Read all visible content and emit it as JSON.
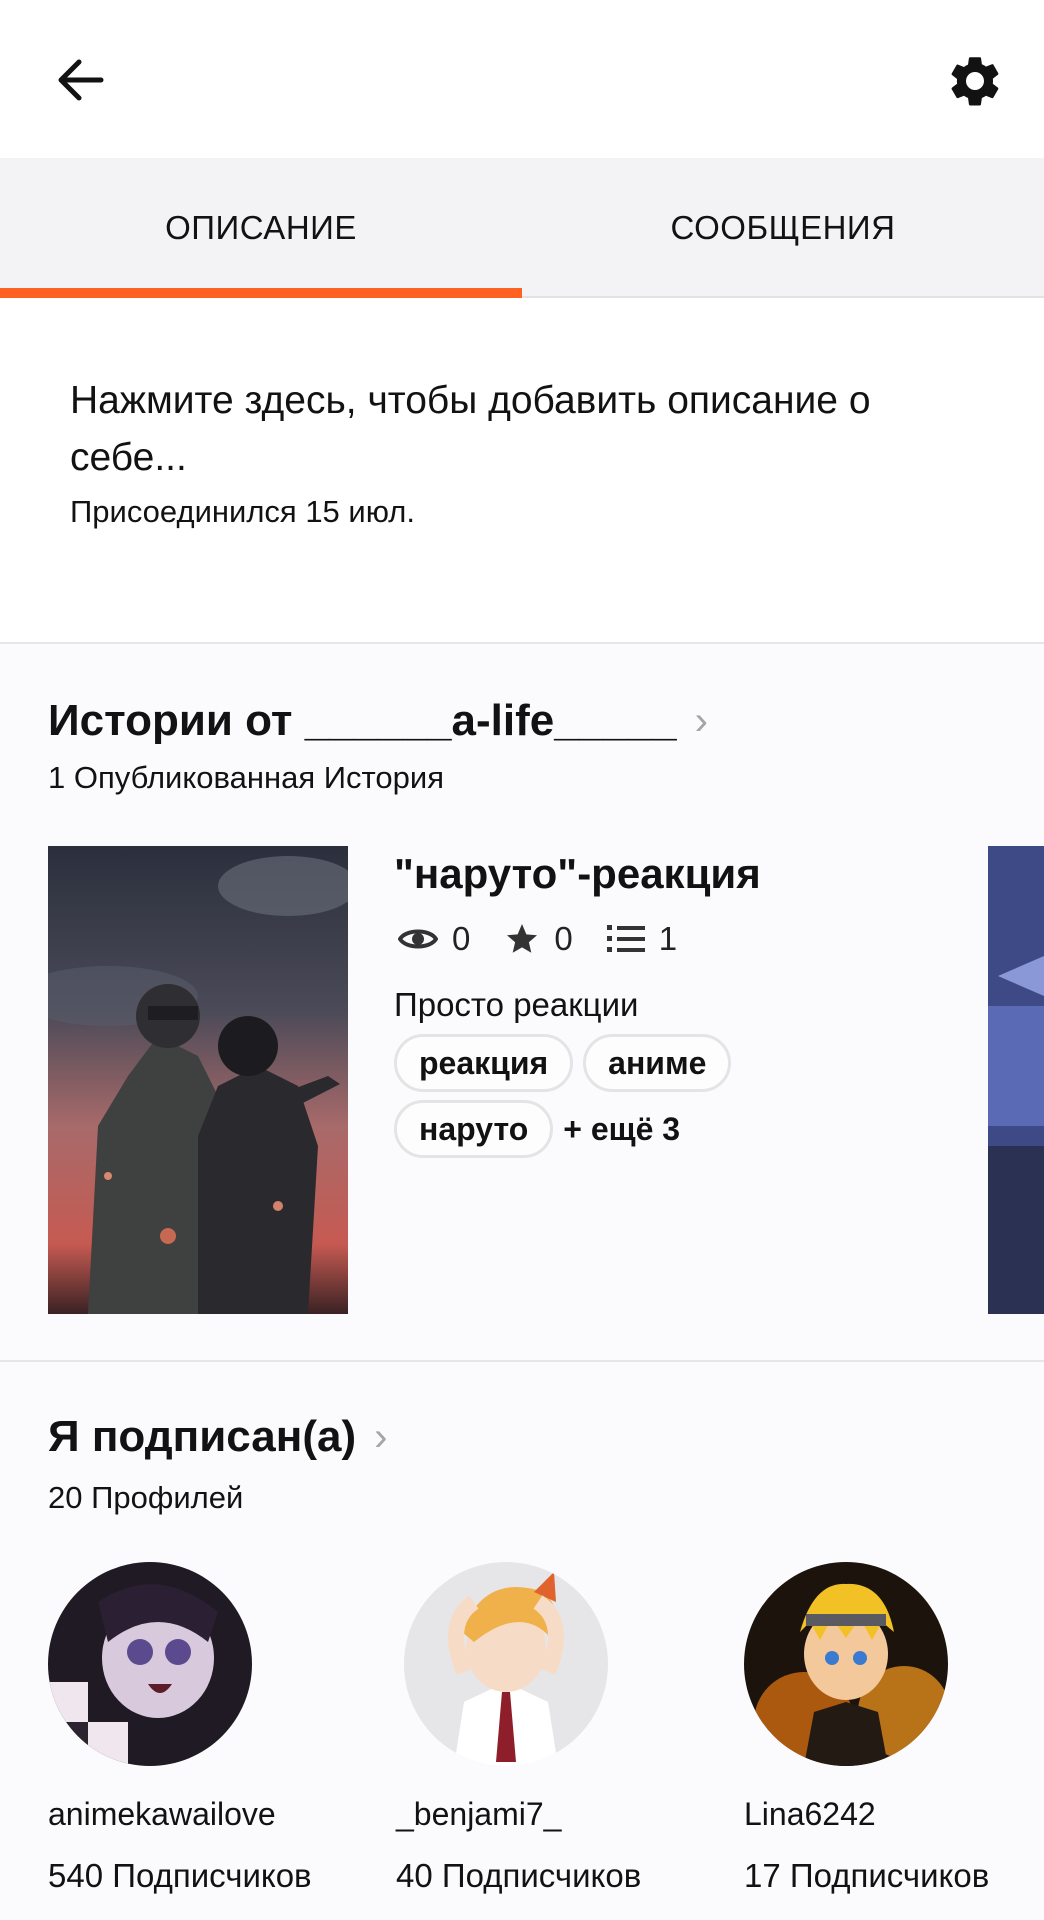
{
  "header": {
    "back_icon": "arrow-left-icon",
    "settings_icon": "gear-icon"
  },
  "tabs": [
    {
      "label": "ОПИСАНИЕ",
      "active": true
    },
    {
      "label": "СООБЩЕНИЯ",
      "active": false
    }
  ],
  "accent_color": "#ff6122",
  "about": {
    "placeholder": "Нажмите здесь, чтобы добавить описание о себе...",
    "joined": "Присоединился 15 июл."
  },
  "stories": {
    "title": "Истории от ______a-life_____",
    "count_label": "1 Опубликованная История",
    "items": [
      {
        "title": "\"наруто\"-реакция",
        "views": "0",
        "votes": "0",
        "parts": "1",
        "description": "Просто реакции",
        "tags": [
          "реакция",
          "аниме",
          "наруто"
        ],
        "more_tags": "+ ещё 3"
      }
    ]
  },
  "following": {
    "title": "Я подписан(а)",
    "count_label": "20 Профилей",
    "profiles": [
      {
        "name": "animekawailove",
        "followers": "540 Подписчиков"
      },
      {
        "name": "_benjami7_",
        "followers": "40 Подписчиков"
      },
      {
        "name": "Lina6242",
        "followers": "17 Подписчиков"
      }
    ]
  }
}
